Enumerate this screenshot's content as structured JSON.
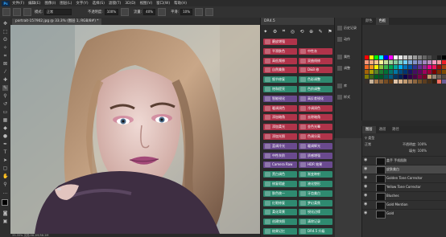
{
  "app": {
    "logo": "Ps"
  },
  "menubar": {
    "items": [
      "文件(F)",
      "编辑(E)",
      "图像(I)",
      "图层(L)",
      "文字(Y)",
      "选择(S)",
      "滤镜(T)",
      "3D(D)",
      "视图(V)",
      "窗口(W)",
      "帮助(H)"
    ]
  },
  "options": {
    "mode_label": "模式:",
    "mode_value": "正常",
    "opacity_label": "不透明度:",
    "opacity_value": "100%",
    "flow_label": "流量:",
    "flow_value": "40%",
    "smooth_label": "平滑:",
    "smooth_value": "10%"
  },
  "document": {
    "tab_title": "portrait-157902.jpg @ 33.3% (图层 1, RGB/8#) *",
    "status": "33.33%   文档:58.2M/58.2M"
  },
  "plugin": {
    "title": "DR4.5",
    "top_icons": [
      "✦",
      "⚙",
      "⌗",
      "◎",
      "⟲",
      "⊕",
      "✎",
      "⚑"
    ],
    "rows": [
      {
        "left": "磨皮增强",
        "right": "",
        "color": "#b0344a"
      },
      {
        "left": "平滑肤色",
        "right": "中性灰",
        "color": "#b0344a"
      },
      {
        "left": "高低频修",
        "right": "双曲线修",
        "color": "#b0344a"
      },
      {
        "left": "自然美肤",
        "right": "D&B 修",
        "color": "#b0344a"
      },
      {
        "left": "细节修复",
        "right": "色彩调整",
        "color": "#2f8a70"
      },
      {
        "left": "饱和提亮",
        "right": "色阶调整",
        "color": "#2f8a70"
      },
      {
        "left": "智能锐化",
        "right": "高反差锐化",
        "color": "#6a4a8f"
      },
      {
        "left": "暖调润色",
        "right": "冷调润色",
        "color": "#b0344a"
      },
      {
        "left": "添加暗角",
        "right": "去除暗角",
        "color": "#b0344a"
      },
      {
        "left": "添加柔光",
        "right": "金色光晕",
        "color": "#b0344a"
      },
      {
        "left": "添加光照",
        "right": "色调分离",
        "color": "#b0344a"
      },
      {
        "left": "蓝调冷光",
        "right": "暖调辉光",
        "color": "#6a4a8f"
      },
      {
        "left": "中性灰阶",
        "right": "质感增强",
        "color": "#6a4a8f"
      },
      {
        "left": "Camera Raw",
        "right": "HDR 效果",
        "color": "#6a4a8f"
      },
      {
        "left": "黑白调色",
        "right": "渐变映射",
        "color": "#2f8a70"
      },
      {
        "left": "修复瑕疵",
        "right": "液化塑形",
        "color": "#2f8a70"
      },
      {
        "left": "肤色统一",
        "right": "牙齿美白",
        "color": "#2f8a70"
      },
      {
        "left": "红眼修复",
        "right": "梦幻柔焦",
        "color": "#2f8a70"
      },
      {
        "left": "柔化背景",
        "right": "锐化边缘",
        "color": "#2f8a70"
      },
      {
        "left": "创建快照",
        "right": "清除记录",
        "color": "#2f8a70"
      },
      {
        "left": "结果记忆",
        "right": "DR4.5 升级",
        "color": "#2f8a70"
      }
    ]
  },
  "rightstrip": {
    "items": [
      "历史记录",
      "动作",
      "属性",
      "调整",
      "库",
      "样式"
    ]
  },
  "swatches_panel": {
    "tabs": [
      "颜色",
      "色板"
    ],
    "colors": [
      "#ff0000",
      "#ffff00",
      "#00ff00",
      "#00ffff",
      "#0000ff",
      "#ff00ff",
      "#ffffff",
      "#e6e6e6",
      "#cccccc",
      "#b3b3b3",
      "#999999",
      "#808080",
      "#666666",
      "#4d4d4d",
      "#333333",
      "#1a1a1a",
      "#000000",
      "#f7977a",
      "#f9ad81",
      "#fdc68a",
      "#fff79a",
      "#c4df9b",
      "#a2d39c",
      "#82ca9d",
      "#7bcdc8",
      "#6ecff6",
      "#7ea7d8",
      "#8493ca",
      "#8882be",
      "#a187be",
      "#bc8dbf",
      "#f49ac2",
      "#f6989d",
      "#ed1c24",
      "#f26522",
      "#f7941d",
      "#fff200",
      "#8dc63f",
      "#39b54a",
      "#00a651",
      "#00a99d",
      "#00aeef",
      "#0072bc",
      "#0054a6",
      "#2e3192",
      "#662d91",
      "#92278f",
      "#ec008c",
      "#ed145b",
      "#9e0b0f",
      "#a0410d",
      "#a36209",
      "#aba000",
      "#598527",
      "#1a7b30",
      "#007236",
      "#00746b",
      "#0076a3",
      "#004b80",
      "#003471",
      "#1b1464",
      "#440e62",
      "#630460",
      "#9e005d",
      "#9e0039",
      "#790000",
      "#7b2e00",
      "#7d4900",
      "#827b00",
      "#406618",
      "#005e20",
      "#005826",
      "#005952",
      "#005b7f",
      "#003663",
      "#002157",
      "#0d004c",
      "#32004b",
      "#4b0049",
      "#7b0046",
      "#7a0026",
      "#c69c6e",
      "#998675",
      "#736357",
      "#534741",
      "#362f2d",
      "#c7b299",
      "#a67c52",
      "#8c6239",
      "#754c24",
      "#603913",
      "#e0c4a8",
      "#d9b38c",
      "#bf9970",
      "#a67f59",
      "#8c6640",
      "#735027",
      "#5c3d1f",
      "#452e17",
      "#2e1f10",
      "#ff6f61",
      "#6b5b95"
    ]
  },
  "layers_panel": {
    "tabs": [
      "图层",
      "通道",
      "路径"
    ],
    "kind_label": "类型",
    "mode_value": "正常",
    "opacity_label": "不透明度:",
    "opacity_value": "100%",
    "fill_label": "填充:",
    "fill_value": "100%",
    "layers": [
      {
        "name": "盖手 手机肌肤",
        "selected": false
      },
      {
        "name": "皮肤美白",
        "selected": true
      },
      {
        "name": "Golden Tone Corrector",
        "selected": false
      },
      {
        "name": "Yellow Tone Corrector",
        "selected": false
      },
      {
        "name": "Blushes",
        "selected": false
      },
      {
        "name": "Gold Mention",
        "selected": false
      },
      {
        "name": "Gold",
        "selected": false
      }
    ]
  }
}
